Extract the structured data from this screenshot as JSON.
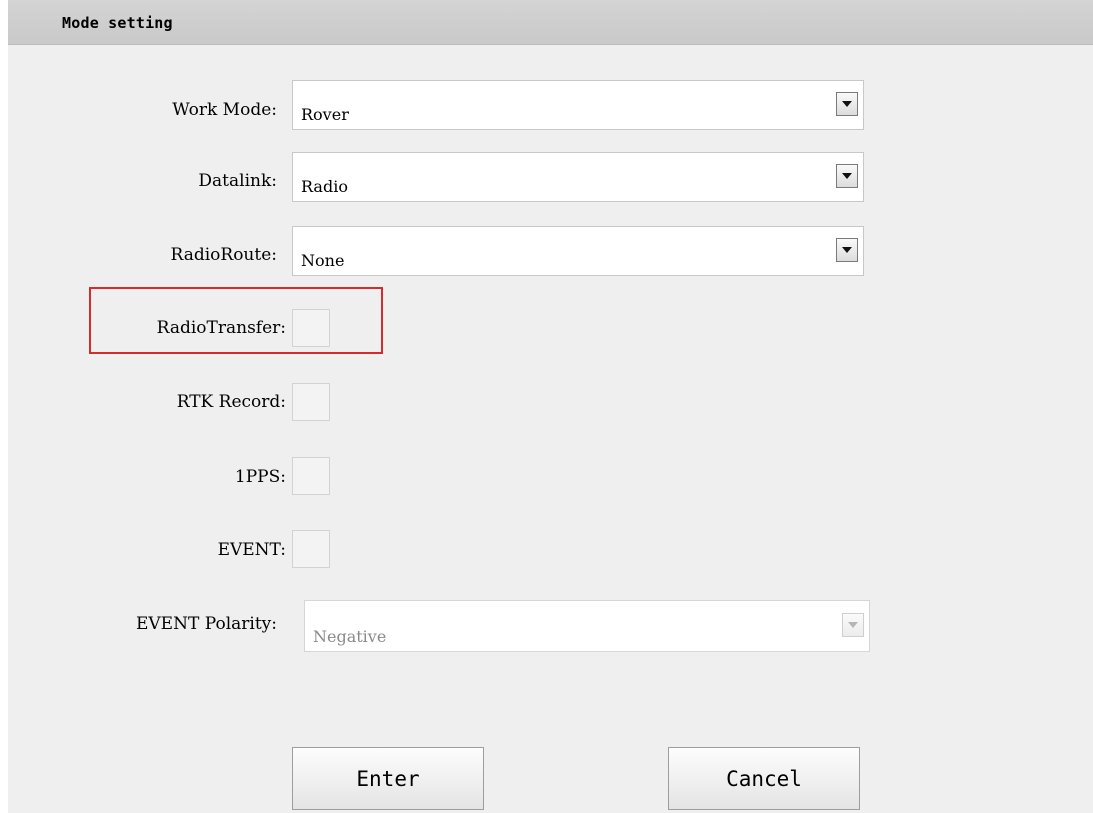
{
  "dialog": {
    "title": "Mode setting"
  },
  "fields": {
    "work_mode": {
      "label": "Work Mode:",
      "value": "Rover"
    },
    "datalink": {
      "label": "Datalink:",
      "value": "Radio"
    },
    "radio_route": {
      "label": "RadioRoute:",
      "value": "None"
    },
    "radio_transfer": {
      "label": "RadioTransfer:",
      "checked": false
    },
    "rtk_record": {
      "label": "RTK Record:",
      "checked": false
    },
    "pps": {
      "label": "1PPS:",
      "checked": false
    },
    "event": {
      "label": "EVENT:",
      "checked": false
    },
    "event_polarity": {
      "label": "EVENT Polarity:",
      "value": "Negative",
      "enabled": false
    }
  },
  "buttons": {
    "enter": "Enter",
    "cancel": "Cancel"
  },
  "highlight_color": "#d52b2b"
}
